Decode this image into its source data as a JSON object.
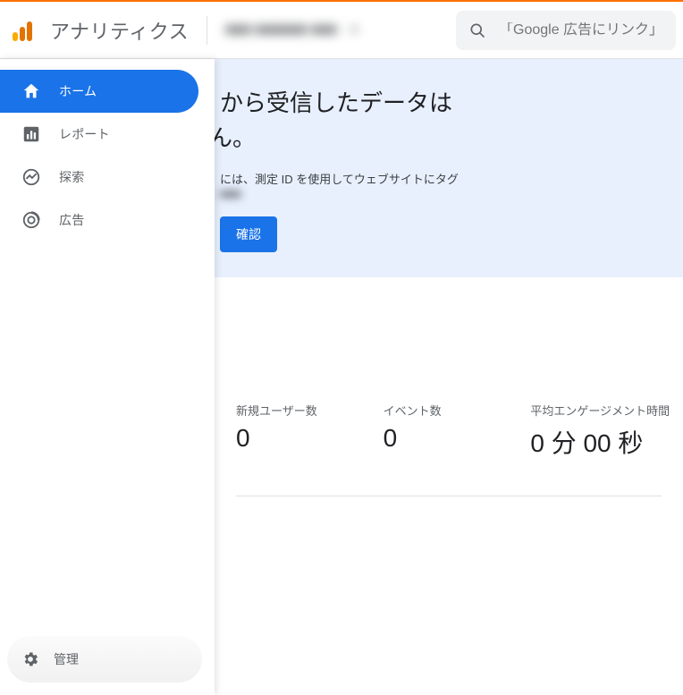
{
  "header": {
    "product_name": "アナリティクス",
    "property_label": "■■■  ■■■■■■ ■■■",
    "search_placeholder": "「Google 広告にリンク」"
  },
  "sidebar": {
    "items": [
      {
        "label": "ホーム"
      },
      {
        "label": "レポート"
      },
      {
        "label": "探索"
      },
      {
        "label": "広告"
      }
    ],
    "admin_label": "管理"
  },
  "banner": {
    "title_line1": "から受信したデータは",
    "title_line2": "ん。",
    "desc": "には、測定 ID を使用してウェブサイトにタグ",
    "desc_blur": "■■■",
    "button": "確認"
  },
  "metrics": [
    {
      "label": "新規ユーザー数",
      "value": "0"
    },
    {
      "label": "イベント数",
      "value": "0"
    },
    {
      "label": "平均エンゲージメント時間",
      "value": "0 分 00 秒"
    }
  ]
}
